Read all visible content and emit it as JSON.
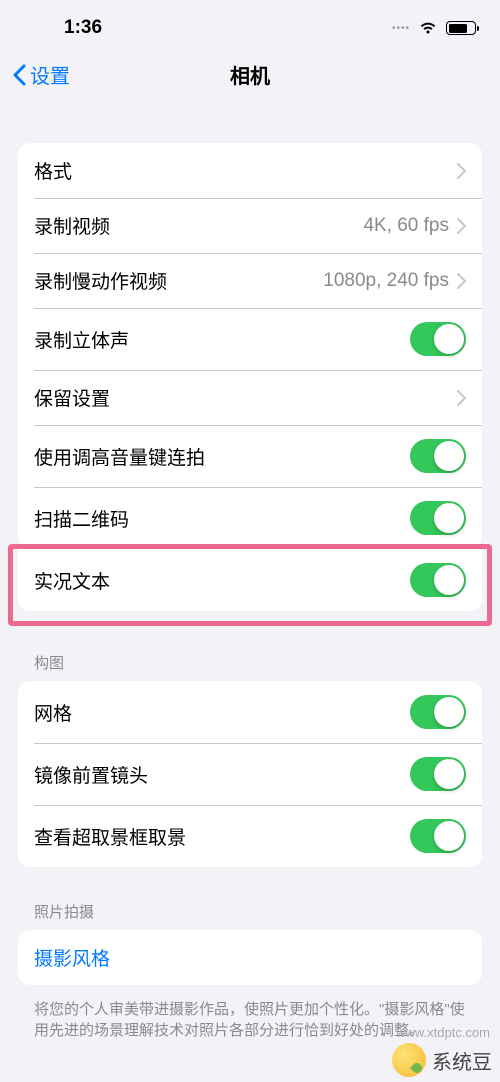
{
  "statusBar": {
    "time": "1:36"
  },
  "nav": {
    "back": "设置",
    "title": "相机"
  },
  "group1": {
    "format": {
      "label": "格式"
    },
    "recordVideo": {
      "label": "录制视频",
      "detail": "4K, 60 fps"
    },
    "recordSlomo": {
      "label": "录制慢动作视频",
      "detail": "1080p, 240 fps"
    },
    "stereo": {
      "label": "录制立体声"
    },
    "preserve": {
      "label": "保留设置"
    },
    "volumeBurst": {
      "label": "使用调高音量键连拍"
    },
    "scanQR": {
      "label": "扫描二维码"
    },
    "liveText": {
      "label": "实况文本"
    }
  },
  "section2": {
    "header": "构图",
    "grid": {
      "label": "网格"
    },
    "mirrorFront": {
      "label": "镜像前置镜头"
    },
    "viewOutside": {
      "label": "查看超取景框取景"
    }
  },
  "section3": {
    "header": "照片拍摄",
    "photoStyles": {
      "label": "摄影风格"
    },
    "footer": "将您的个人审美带进摄影作品，使照片更加个性化。\"摄影风格\"使用先进的场景理解技术对照片各部分进行恰到好处的调整。"
  },
  "watermark": {
    "text": "系统豆",
    "url": "www.xtdptc.com"
  }
}
